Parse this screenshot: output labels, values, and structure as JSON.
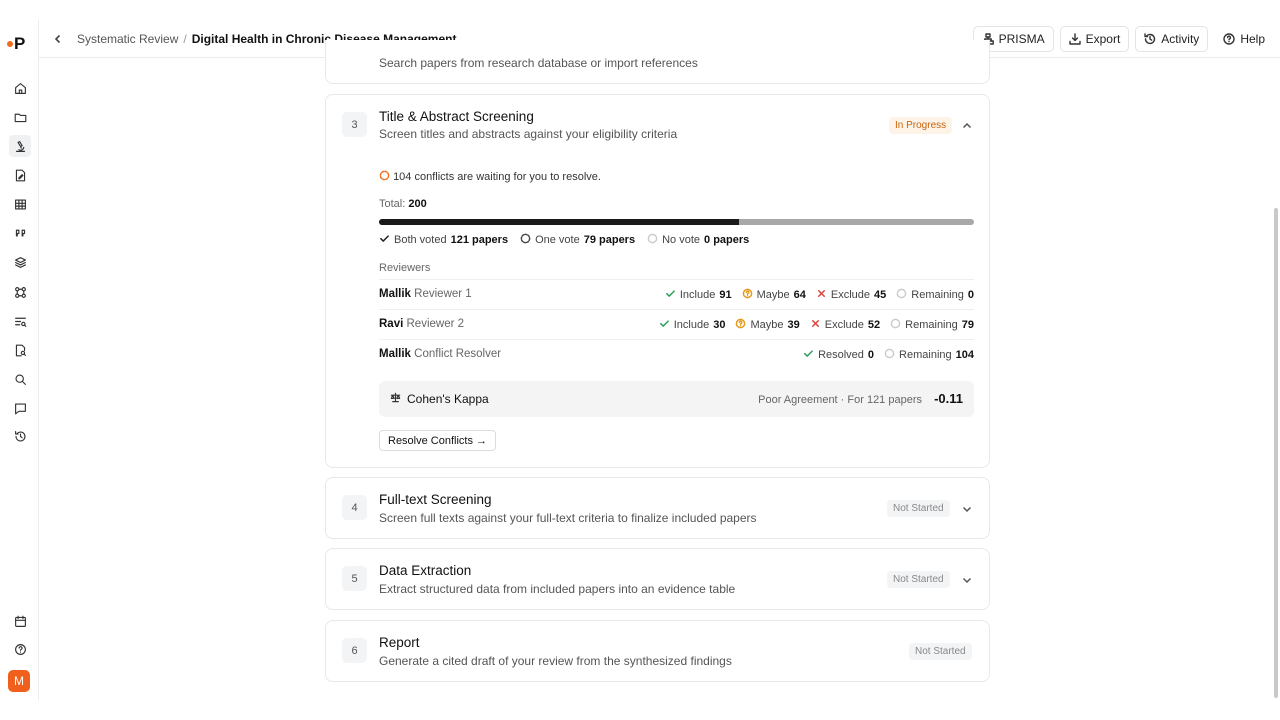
{
  "app": {
    "logo": "P"
  },
  "header": {
    "breadcrumb_parent": "Systematic Review",
    "breadcrumb_sep": "/",
    "breadcrumb_current": "Digital Health in Chronic Disease Management",
    "actions": {
      "prisma": "PRISMA",
      "export": "Export",
      "activity": "Activity",
      "help": "Help"
    }
  },
  "user": {
    "avatar_initial": "M"
  },
  "steps": {
    "s2": {
      "subtitle": "Search papers from research database or import references"
    },
    "s3": {
      "number": "3",
      "title": "Title & Abstract Screening",
      "subtitle": "Screen titles and abstracts against your eligibility criteria",
      "status": "In Progress",
      "conflict_notice": "104 conflicts are waiting for you to resolve.",
      "total_label": "Total:",
      "total": "200",
      "progress": 0.605,
      "legend": {
        "both_label": "Both voted",
        "both_value": "121 papers",
        "one_label": "One vote",
        "one_value": "79 papers",
        "none_label": "No vote",
        "none_value": "0 papers"
      },
      "reviewers_heading": "Reviewers",
      "reviewers": [
        {
          "name": "Mallik",
          "role": "Reviewer 1",
          "include_label": "Include",
          "include": "91",
          "maybe_label": "Maybe",
          "maybe": "64",
          "exclude_label": "Exclude",
          "exclude": "45",
          "remaining_label": "Remaining",
          "remaining": "0"
        },
        {
          "name": "Ravi",
          "role": "Reviewer 2",
          "include_label": "Include",
          "include": "30",
          "maybe_label": "Maybe",
          "maybe": "39",
          "exclude_label": "Exclude",
          "exclude": "52",
          "remaining_label": "Remaining",
          "remaining": "79"
        }
      ],
      "resolver": {
        "name": "Mallik",
        "role": "Conflict Resolver",
        "resolved_label": "Resolved",
        "resolved": "0",
        "remaining_label": "Remaining",
        "remaining": "104"
      },
      "kappa": {
        "label": "Cohen's Kappa",
        "description": "Poor Agreement · For 121 papers",
        "value": "-0.11"
      },
      "resolve_button": "Resolve Conflicts →"
    },
    "s4": {
      "number": "4",
      "title": "Full-text Screening",
      "subtitle": "Screen full texts against your full-text criteria to finalize included papers",
      "status": "Not Started"
    },
    "s5": {
      "number": "5",
      "title": "Data Extraction",
      "subtitle": "Extract structured data from included papers into an evidence table",
      "status": "Not Started"
    },
    "s6": {
      "number": "6",
      "title": "Report",
      "subtitle": "Generate a cited draft of your review from the synthesized findings",
      "status": "Not Started"
    }
  },
  "colors": {
    "accent": "#f26b1d",
    "in_progress": "#c8640d",
    "include": "#2f9e58",
    "maybe": "#e49a1b",
    "exclude": "#d9443a"
  }
}
